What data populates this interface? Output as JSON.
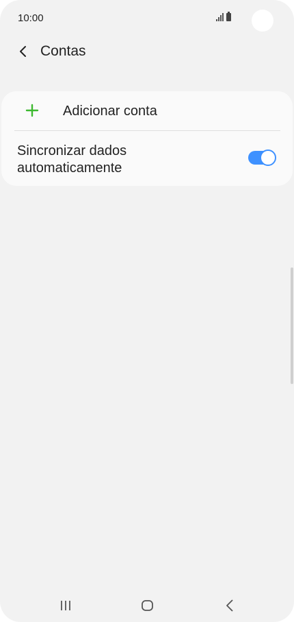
{
  "status_bar": {
    "time": "10:00",
    "icons": [
      "signal-icon",
      "battery-icon"
    ]
  },
  "header": {
    "back_icon": "chevron-left-icon",
    "title": "Contas"
  },
  "card": {
    "add_account": {
      "icon": "plus-icon",
      "icon_color": "#3cb82f",
      "label": "Adicionar conta"
    },
    "auto_sync": {
      "label": "Sincronizar dados automaticamente",
      "enabled": true,
      "toggle_color": "#3e91ff"
    }
  },
  "nav_bar": {
    "items": [
      "recents-icon",
      "home-icon",
      "back-icon"
    ]
  }
}
